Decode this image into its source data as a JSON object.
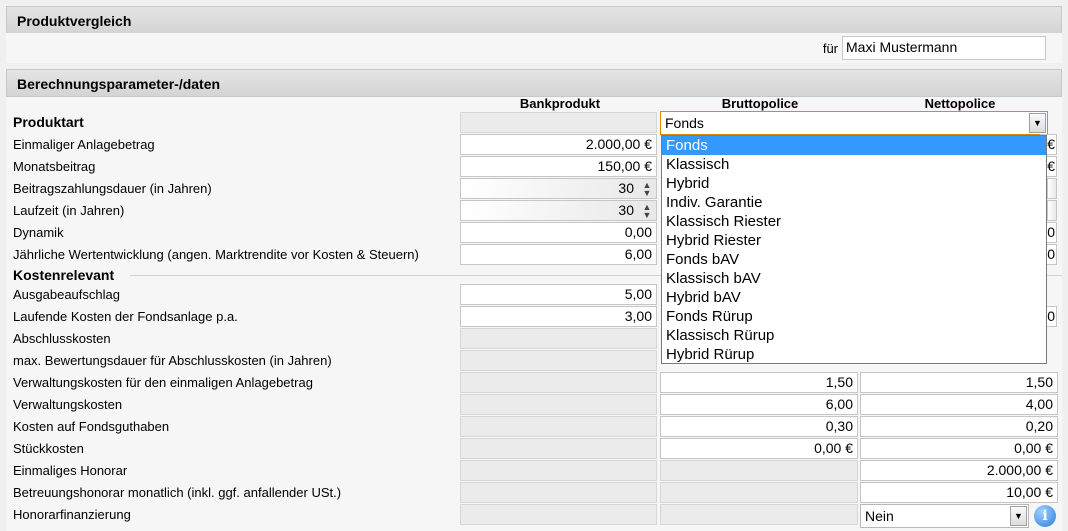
{
  "header1": "Produktvergleich",
  "fuer_label": "für",
  "client_name": "Maxi Mustermann",
  "header2": "Berechnungsparameter-/daten",
  "columns": [
    "Bankprodukt",
    "Bruttopolice",
    "Nettopolice"
  ],
  "produktart": {
    "label": "Produktart",
    "brutto_selected": "Fonds",
    "options": [
      "Fonds",
      "Klassisch",
      "Hybrid",
      "Indiv. Garantie",
      "Klassisch Riester",
      "Hybrid Riester",
      "Fonds bAV",
      "Klassisch bAV",
      "Hybrid bAV",
      "Fonds Rürup",
      "Klassisch Rürup",
      "Hybrid Rürup"
    ]
  },
  "rows": {
    "einmalig": {
      "label": "Einmaliger Anlagebetrag",
      "bank": "2.000,00 €",
      "netto": "€"
    },
    "monat": {
      "label": "Monatsbeitrag",
      "bank": "150,00 €",
      "netto": "€"
    },
    "beitragsdauer": {
      "label": "Beitragszahlungsdauer (in Jahren)",
      "bank": "30"
    },
    "laufzeit": {
      "label": "Laufzeit (in Jahren)",
      "bank": "30"
    },
    "dynamik": {
      "label": "Dynamik",
      "bank": "0,00",
      "netto": "0"
    },
    "wert": {
      "label": "Jährliche Wertentwicklung (angen. Marktrendite vor Kosten & Steuern)",
      "bank": "6,00",
      "netto": "0"
    },
    "kosten_section": "Kostenrelevant",
    "ausgabe": {
      "label": "Ausgabeaufschlag",
      "bank": "5,00"
    },
    "laufende": {
      "label": "Laufende Kosten der Fondsanlage p.a.",
      "bank": "3,00",
      "netto": "0"
    },
    "abschluss": {
      "label": "Abschlusskosten"
    },
    "bewertung": {
      "label": "max. Bewertungsdauer für Abschlusskosten (in Jahren)"
    },
    "verw_einmalig": {
      "label": "Verwaltungskosten für den einmaligen Anlagebetrag",
      "brutto": "1,50",
      "netto": "1,50"
    },
    "verw": {
      "label": "Verwaltungskosten",
      "brutto": "6,00",
      "netto": "4,00"
    },
    "fondsguthaben": {
      "label": "Kosten auf Fondsguthaben",
      "brutto": "0,30",
      "netto": "0,20"
    },
    "stueck": {
      "label": "Stückkosten",
      "brutto": "0,00 €",
      "netto": "0,00 €"
    },
    "honorar": {
      "label": "Einmaliges Honorar",
      "netto": "2.000,00 €"
    },
    "betreuung": {
      "label": "Betreuungshonorar monatlich (inkl. ggf. anfallender USt.)",
      "netto": "10,00 €"
    },
    "finanzierung": {
      "label": "Honorarfinanzierung",
      "netto": "Nein"
    }
  }
}
